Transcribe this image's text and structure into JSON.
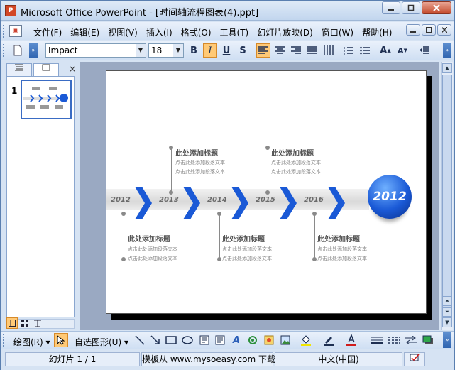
{
  "window": {
    "title": "Microsoft Office PowerPoint - [时间轴流程图表(4).ppt]",
    "app_icon_letter": "P"
  },
  "menu": {
    "items": [
      "文件(F)",
      "编辑(E)",
      "视图(V)",
      "插入(I)",
      "格式(O)",
      "工具(T)",
      "幻灯片放映(D)",
      "窗口(W)",
      "帮助(H)"
    ]
  },
  "format_toolbar": {
    "font_name": "Impact",
    "font_size": "18",
    "bold": "B",
    "italic": "I",
    "underline": "U",
    "shadow": "S"
  },
  "left_pane": {
    "slide_number": "1",
    "close": "×"
  },
  "slide": {
    "years": [
      "2012",
      "2013",
      "2014",
      "2015",
      "2016"
    ],
    "globe_year": "2012",
    "event_title": "此处添加标题",
    "event_line": "点击此处添加段落文本"
  },
  "draw_toolbar": {
    "draw_label": "绘图(R) ▾",
    "autoshapes_label": "自选图形(U) ▾"
  },
  "status": {
    "slide_counter": "幻灯片 1 / 1",
    "template": "模板从 www.mysoeasy.com 下载",
    "language": "中文(中国)"
  },
  "colors": {
    "accent_blue": "#1a59d6",
    "active_button": "#ffc976"
  }
}
